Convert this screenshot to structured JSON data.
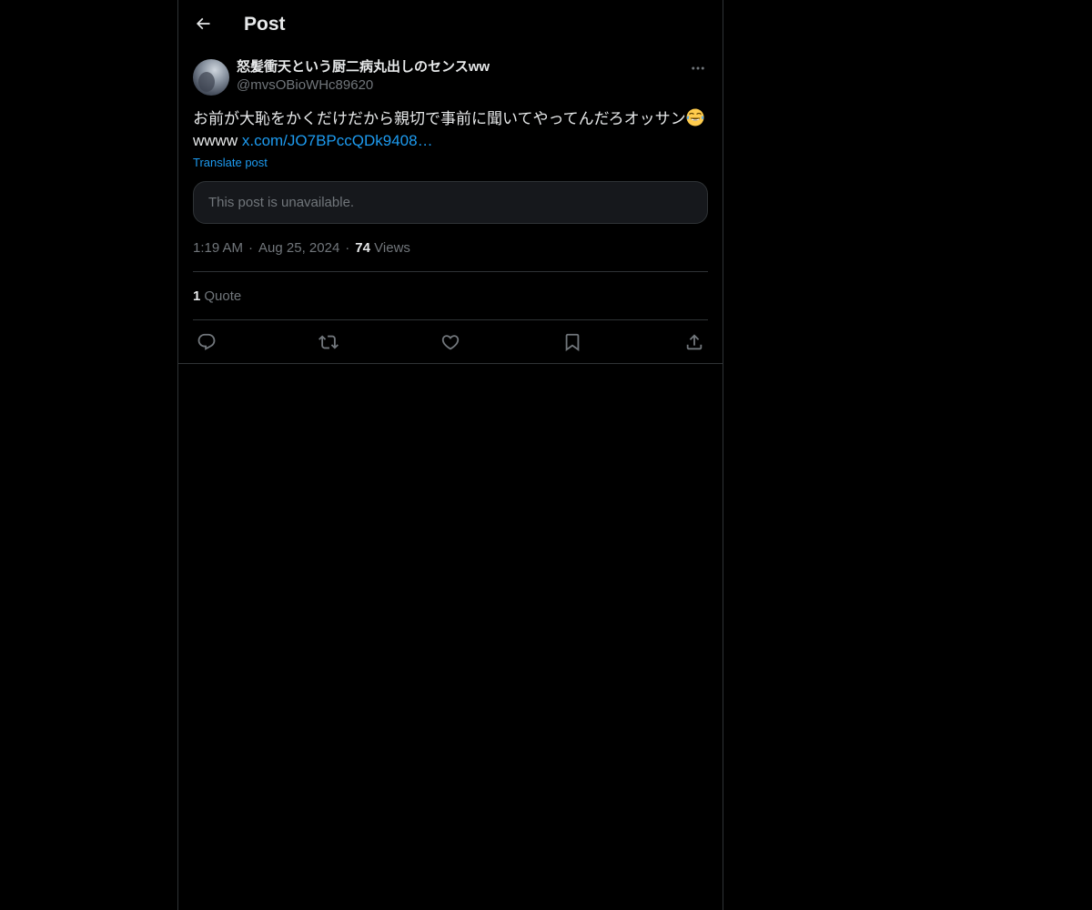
{
  "header": {
    "title": "Post",
    "back_icon": "arrow-left-icon"
  },
  "post": {
    "author": {
      "display_name": "怒髪衝天という厨二病丸出しのセンスww",
      "handle": "@mvsOBioWHc89620"
    },
    "more_icon": "more-horizontal-icon",
    "text_line1": "お前が大恥をかくだけだから親切で事前に聞いてやってんだろオッサン",
    "emoji": "face-with-tears-of-joy",
    "text_line2_prefix": "wwww ",
    "link_text": "x.com/JO7BPccQDk9408…",
    "translate_label": "Translate post",
    "unavailable_text": "This post is unavailable.",
    "time": "1:19 AM",
    "date": "Aug 25, 2024",
    "separator": "·",
    "views_count": "74",
    "views_label": "Views",
    "quote_count": "1",
    "quote_label": "Quote"
  },
  "actions": [
    {
      "name": "reply",
      "icon": "reply-icon"
    },
    {
      "name": "repost",
      "icon": "repost-icon"
    },
    {
      "name": "like",
      "icon": "heart-icon"
    },
    {
      "name": "bookmark",
      "icon": "bookmark-icon"
    },
    {
      "name": "share",
      "icon": "share-icon"
    }
  ],
  "colors": {
    "background": "#000000",
    "text": "#e7e9ea",
    "secondary": "#71767b",
    "accent": "#1d9bf0",
    "border": "#2f3336"
  }
}
